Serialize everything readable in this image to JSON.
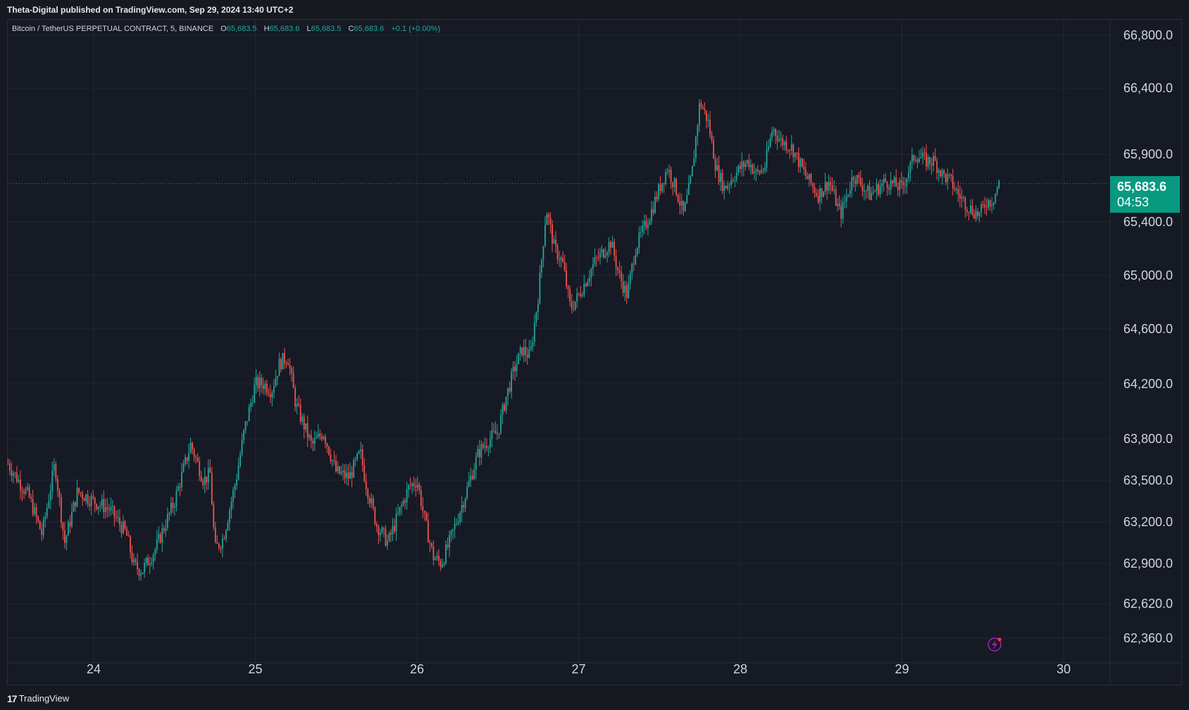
{
  "header": {
    "publisher_line": "Theta-Digital published on TradingView.com, Sep 29, 2024 13:40 UTC+2"
  },
  "legend": {
    "symbol": "Bitcoin / TetherUS PERPETUAL CONTRACT, 5, BINANCE",
    "open_label": "O",
    "open": "65,683.5",
    "high_label": "H",
    "high": "65,683.6",
    "low_label": "L",
    "low": "65,683.5",
    "close_label": "C",
    "close": "65,683.6",
    "change": "+0.1 (+0.00%)"
  },
  "price_badge": {
    "price": "65,683.6",
    "countdown": "04:53"
  },
  "footer": {
    "brand": "TradingView",
    "logo": "17"
  },
  "colors": {
    "up": "#26a69a",
    "down": "#ef5350",
    "background": "#161a25",
    "grid": "#232733",
    "badge": "#089981"
  },
  "chart_data": {
    "type": "candlestick",
    "xlabel": "",
    "ylabel": "",
    "x_ticks": [
      "24",
      "25",
      "26",
      "27",
      "28",
      "29",
      "30"
    ],
    "y_ticks": [
      62360,
      62620,
      62900,
      63200,
      63500,
      63800,
      64200,
      64600,
      65000,
      65400,
      65900,
      66400,
      66800
    ],
    "y_tick_labels": [
      "62,360.0",
      "62,620.0",
      "62,900.0",
      "63,200.0",
      "63,500.0",
      "63,800.0",
      "64,200.0",
      "64,600.0",
      "65,000.0",
      "65,400.0",
      "65,900.0",
      "66,400.0",
      "66,800.0"
    ],
    "ylim": [
      62200,
      66900
    ],
    "xlim_days": [
      23.47,
      30.25
    ],
    "last_price": 65683.6,
    "series": [
      {
        "values": [
          [
            23.47,
            63620
          ],
          [
            23.6,
            63380
          ],
          [
            23.68,
            63110
          ],
          [
            23.76,
            63620
          ],
          [
            23.82,
            63050
          ],
          [
            23.9,
            63420
          ],
          [
            24.0,
            63350
          ],
          [
            24.1,
            63290
          ],
          [
            24.2,
            63120
          ],
          [
            24.25,
            62880
          ],
          [
            24.3,
            62850
          ],
          [
            24.38,
            63000
          ],
          [
            24.5,
            63350
          ],
          [
            24.6,
            63760
          ],
          [
            24.68,
            63500
          ],
          [
            24.72,
            63550
          ],
          [
            24.75,
            63000
          ],
          [
            24.8,
            63080
          ],
          [
            24.88,
            63500
          ],
          [
            24.93,
            63850
          ],
          [
            25.0,
            64200
          ],
          [
            25.05,
            64200
          ],
          [
            25.1,
            64150
          ],
          [
            25.15,
            64350
          ],
          [
            25.2,
            64400
          ],
          [
            25.25,
            64050
          ],
          [
            25.35,
            63750
          ],
          [
            25.42,
            63850
          ],
          [
            25.5,
            63560
          ],
          [
            25.58,
            63520
          ],
          [
            25.65,
            63700
          ],
          [
            25.68,
            63500
          ],
          [
            25.75,
            63180
          ],
          [
            25.82,
            63050
          ],
          [
            25.9,
            63300
          ],
          [
            25.95,
            63450
          ],
          [
            26.0,
            63500
          ],
          [
            26.05,
            63200
          ],
          [
            26.1,
            62950
          ],
          [
            26.15,
            62900
          ],
          [
            26.2,
            63050
          ],
          [
            26.3,
            63400
          ],
          [
            26.38,
            63700
          ],
          [
            26.45,
            63800
          ],
          [
            26.5,
            63850
          ],
          [
            26.55,
            64100
          ],
          [
            26.6,
            64300
          ],
          [
            26.65,
            64450
          ],
          [
            26.7,
            64400
          ],
          [
            26.75,
            64850
          ],
          [
            26.8,
            65500
          ],
          [
            26.85,
            65200
          ],
          [
            26.9,
            65100
          ],
          [
            26.95,
            64750
          ],
          [
            27.0,
            64850
          ],
          [
            27.1,
            65100
          ],
          [
            27.2,
            65250
          ],
          [
            27.25,
            65000
          ],
          [
            27.3,
            64850
          ],
          [
            27.35,
            65200
          ],
          [
            27.45,
            65480
          ],
          [
            27.5,
            65650
          ],
          [
            27.55,
            65800
          ],
          [
            27.6,
            65650
          ],
          [
            27.65,
            65450
          ],
          [
            27.7,
            65750
          ],
          [
            27.75,
            66300
          ],
          [
            27.8,
            66150
          ],
          [
            27.85,
            65800
          ],
          [
            27.9,
            65650
          ],
          [
            28.0,
            65800
          ],
          [
            28.05,
            65850
          ],
          [
            28.1,
            65750
          ],
          [
            28.15,
            65800
          ],
          [
            28.2,
            66100
          ],
          [
            28.25,
            66000
          ],
          [
            28.32,
            65950
          ],
          [
            28.4,
            65750
          ],
          [
            28.48,
            65600
          ],
          [
            28.55,
            65700
          ],
          [
            28.62,
            65450
          ],
          [
            28.7,
            65750
          ],
          [
            28.8,
            65600
          ],
          [
            28.9,
            65700
          ],
          [
            29.0,
            65650
          ],
          [
            29.08,
            65900
          ],
          [
            29.15,
            65850
          ],
          [
            29.2,
            65850
          ],
          [
            29.25,
            65750
          ],
          [
            29.3,
            65700
          ],
          [
            29.35,
            65600
          ],
          [
            29.42,
            65500
          ],
          [
            29.48,
            65450
          ],
          [
            29.52,
            65550
          ],
          [
            29.56,
            65560
          ],
          [
            29.6,
            65683.6
          ]
        ]
      }
    ]
  }
}
